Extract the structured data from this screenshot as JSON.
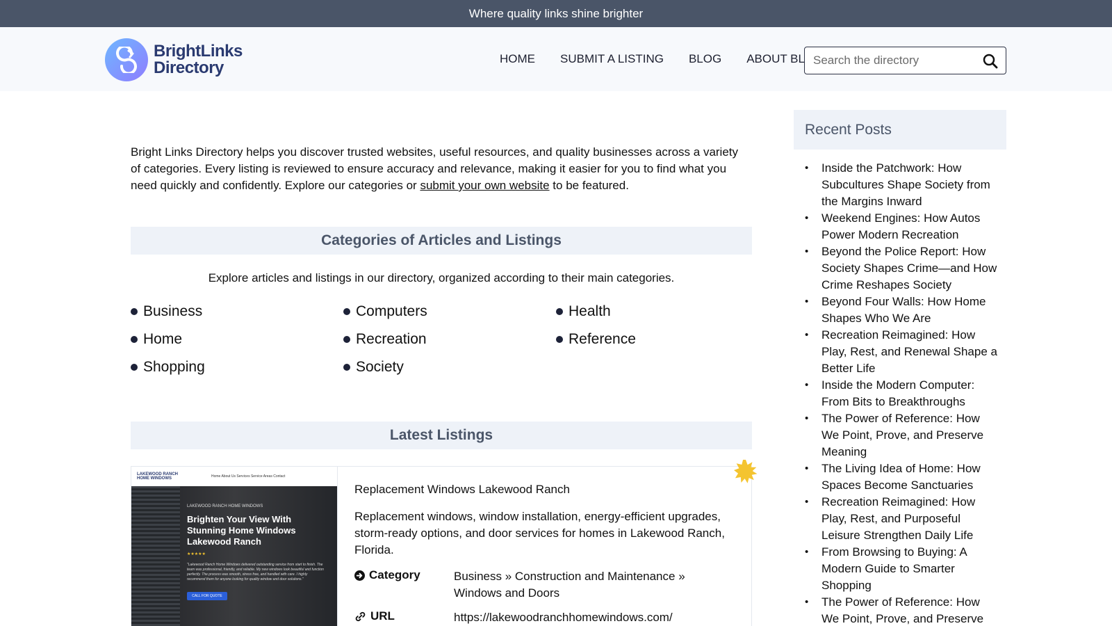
{
  "topbar": {
    "tagline": "Where quality links shine brighter"
  },
  "header": {
    "logo_line1": "BrightLinks",
    "logo_line2": "Directory",
    "nav": [
      "HOME",
      "SUBMIT A LISTING",
      "BLOG",
      "ABOUT BLD"
    ],
    "search_placeholder": "Search the directory"
  },
  "intro": {
    "text_before": "Bright Links Directory helps you discover trusted websites, useful resources, and quality businesses across a variety of categories. Every listing is reviewed to ensure accuracy and relevance, making it easier for you to find what you need quickly and confidently. Explore our categories or ",
    "link_text": "submit your own website",
    "text_after": " to be featured."
  },
  "categories": {
    "title": "Categories of Articles and Listings",
    "subtitle": "Explore articles and listings in our directory, organized according to their main categories.",
    "items": [
      "Business",
      "Computers",
      "Health",
      "Home",
      "Recreation",
      "Reference",
      "Shopping",
      "Society"
    ]
  },
  "latest": {
    "title": "Latest Listings",
    "listing": {
      "name": "Replacement Windows Lakewood Ranch",
      "description": "Replacement windows, window installation, energy-efficient upgrades, storm-ready options, and door services for homes in Lakewood Ranch, Florida.",
      "category_label": "Category",
      "category_value": "Business » Construction and Maintenance » Windows and Doors",
      "url_label": "URL",
      "url_value": "https://lakewoodranchhomewindows.com/",
      "screenshot": {
        "logo_line1": "LAKEWOOD RANCH",
        "logo_line2": "HOME WINDOWS",
        "nav": "Home     About Us     Services     Service Areas     Contact",
        "kicker": "LAKEWOOD RANCH HOME WINDOWS",
        "headline": "Brighten Your View With Stunning Home Windows Lakewood Ranch",
        "stars": "★★★★★",
        "quote": "\"Lakewood Ranch Home Windows delivered outstanding service from start to finish. The team was professional, friendly, and reliable. My new windows look beautiful and function perfectly. The process was smooth, stress free, and handled with care. I highly recommend them for anyone looking for quality window and door solutions.\"",
        "button": "CALL FOR QUOTE"
      }
    }
  },
  "sidebar": {
    "title": "Recent Posts",
    "posts": [
      "Inside the Patchwork: How Subcultures Shape Society from the Margins Inward",
      "Weekend Engines: How Autos Power Modern Recreation",
      "Beyond the Police Report: How Society Shapes Crime—and How Crime Reshapes Society",
      "Beyond Four Walls: How Home Shapes Who We Are",
      "Recreation Reimagined: How Play, Rest, and Renewal Shape a Better Life",
      "Inside the Modern Computer: From Bits to Breakthroughs",
      "The Power of Reference: How We Point, Prove, and Preserve Meaning",
      "The Living Idea of Home: How Spaces Become Sanctuaries",
      "Recreation Reimagined: How Play, Rest, and Purposeful Leisure Strengthen Daily Life",
      "From Browsing to Buying: A Modern Guide to Smarter Shopping",
      "The Power of Reference: How We Point, Prove, and Preserve"
    ]
  },
  "colors": {
    "topbar_bg": "#4a5568",
    "section_bg": "#eef2f8",
    "heading": "#4a5568",
    "badge": "#f4c430"
  }
}
